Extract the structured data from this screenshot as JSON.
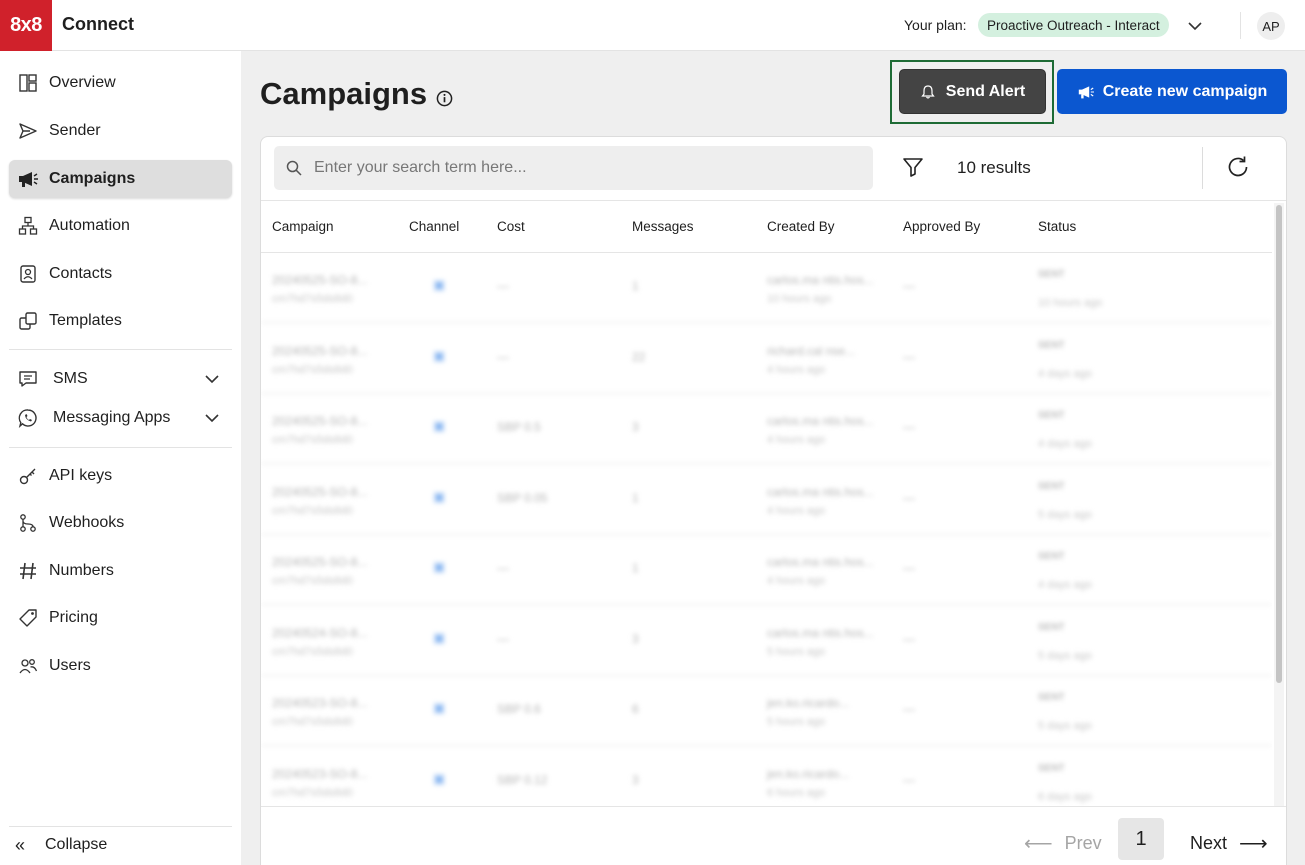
{
  "topbar": {
    "logo_text": "8x8",
    "app_name": "Connect",
    "plan_label": "Your plan:",
    "plan_name": "Proactive Outreach - Interact",
    "avatar_initials": "AP"
  },
  "sidebar": {
    "items": [
      {
        "label": "Overview",
        "icon": "overview-icon"
      },
      {
        "label": "Sender",
        "icon": "send-icon"
      },
      {
        "label": "Campaigns",
        "icon": "megaphone-icon",
        "active": true
      },
      {
        "label": "Automation",
        "icon": "automation-icon"
      },
      {
        "label": "Contacts",
        "icon": "contacts-icon"
      },
      {
        "label": "Templates",
        "icon": "templates-icon"
      },
      {
        "label": "SMS",
        "icon": "sms-icon"
      },
      {
        "label": "Messaging Apps",
        "icon": "whatsapp-icon"
      },
      {
        "label": "API keys",
        "icon": "key-icon"
      },
      {
        "label": "Webhooks",
        "icon": "webhook-icon"
      },
      {
        "label": "Numbers",
        "icon": "hash-icon"
      },
      {
        "label": "Pricing",
        "icon": "tag-icon"
      },
      {
        "label": "Users",
        "icon": "users-icon"
      }
    ],
    "collapse_label": "Collapse"
  },
  "main": {
    "title": "Campaigns",
    "send_alert_label": "Send Alert",
    "create_label": "Create new campaign",
    "search_placeholder": "Enter your search term here...",
    "results_text": "10 results",
    "columns": [
      "Campaign",
      "Channel",
      "Cost",
      "Messages",
      "Created By",
      "Approved By",
      "Status"
    ],
    "rows": [
      {
        "campaign": "20240525-SO-8...",
        "id": "cm7hd7s5ds8d0",
        "cost": "—",
        "messages": "1",
        "created": "carlos.ma ntis.hos...",
        "created_sub": "10 hours ago",
        "approved": "—",
        "status": "SENT",
        "status_sub": "10 hours ago"
      },
      {
        "campaign": "20240525-SO-8...",
        "id": "cm7hd7s5ds8d0",
        "cost": "—",
        "messages": "22",
        "created": "richard.cal nse...",
        "created_sub": "4 hours ago",
        "approved": "—",
        "status": "SENT",
        "status_sub": "4 days ago"
      },
      {
        "campaign": "20240525-SO-8...",
        "id": "cm7hd7s5ds8d0",
        "cost": "SBP 0.5",
        "messages": "3",
        "created": "carlos.ma ntis.hos...",
        "created_sub": "4 hours ago",
        "approved": "—",
        "status": "SENT",
        "status_sub": "4 days ago"
      },
      {
        "campaign": "20240525-SO-8...",
        "id": "cm7hd7s5ds8d0",
        "cost": "SBP 0.05",
        "messages": "1",
        "created": "carlos.ma ntis.hos...",
        "created_sub": "4 hours ago",
        "approved": "—",
        "status": "SENT",
        "status_sub": "5 days ago"
      },
      {
        "campaign": "20240525-SO-8...",
        "id": "cm7hd7s5ds8d0",
        "cost": "—",
        "messages": "1",
        "created": "carlos.ma ntis.hos...",
        "created_sub": "4 hours ago",
        "approved": "—",
        "status": "SENT",
        "status_sub": "4 days ago"
      },
      {
        "campaign": "20240524-SO-8...",
        "id": "cm7hd7s5ds8d0",
        "cost": "—",
        "messages": "3",
        "created": "carlos.ma ntis.hos...",
        "created_sub": "5 hours ago",
        "approved": "—",
        "status": "SENT",
        "status_sub": "5 days ago"
      },
      {
        "campaign": "20240523-SO-8...",
        "id": "cm7hd7s5ds8d0",
        "cost": "SBP 0.6",
        "messages": "6",
        "created": "jen.ko.ricardo...",
        "created_sub": "5 hours ago",
        "approved": "—",
        "status": "SENT",
        "status_sub": "5 days ago"
      },
      {
        "campaign": "20240523-SO-8...",
        "id": "cm7hd7s5ds8d0",
        "cost": "SBP 0.12",
        "messages": "3",
        "created": "jen.ko.ricardo...",
        "created_sub": "6 hours ago",
        "approved": "—",
        "status": "SENT",
        "status_sub": "6 days ago"
      }
    ],
    "pager": {
      "prev_label": "Prev",
      "page": "1",
      "next_label": "Next"
    }
  },
  "colors": {
    "brand_red": "#d0212b",
    "primary_blue": "#0b57d0",
    "alert_dark": "#444444",
    "highlight_green": "#1e6b35",
    "plan_badge_bg": "#d4f0df"
  }
}
